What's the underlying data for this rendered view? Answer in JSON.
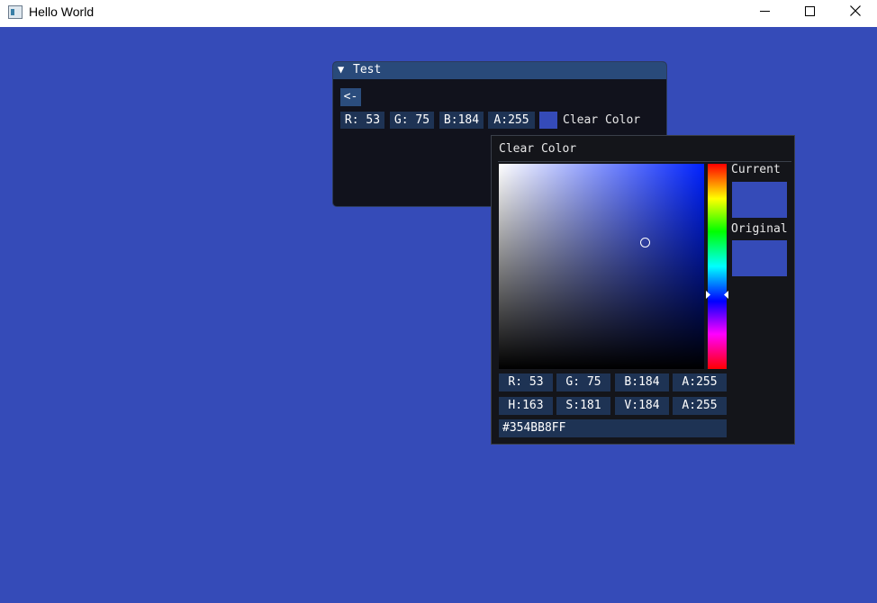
{
  "window": {
    "title": "Hello World",
    "controls": [
      "minimize-icon",
      "maximize-icon",
      "close-icon"
    ]
  },
  "background_color": "#354BB8",
  "test_window": {
    "title": "Test",
    "collapse_icon": "triangle-down-icon",
    "back_button": "<-",
    "rgba_fields": [
      "R: 53",
      "G: 75",
      "B:184",
      "A:255"
    ],
    "swatch_color": "#354BB8",
    "swatch_label": "Clear Color"
  },
  "color_picker": {
    "title": "Clear Color",
    "current_label": "Current",
    "original_label": "Original",
    "current_color": "#354BB8",
    "original_color": "#354BB8",
    "rgba_fields": [
      "R: 53",
      "G: 75",
      "B:184",
      "A:255"
    ],
    "hsva_fields": [
      "H:163",
      "S:181",
      "V:184",
      "A:255"
    ],
    "hex_value": "#354BB8FF"
  }
}
